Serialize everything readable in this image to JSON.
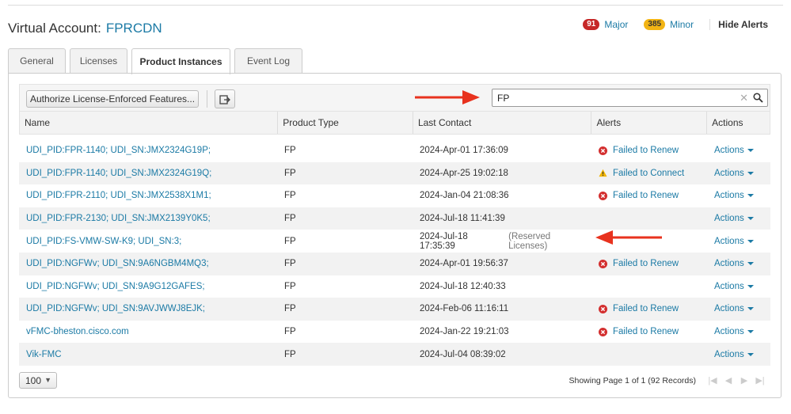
{
  "header": {
    "prefix": "Virtual Account:",
    "account": "FPRCDN"
  },
  "alerts": {
    "major_count": "91",
    "major_label": "Major",
    "minor_count": "385",
    "minor_label": "Minor",
    "hide_label": "Hide Alerts"
  },
  "tabs": [
    {
      "label": "General"
    },
    {
      "label": "Licenses"
    },
    {
      "label": "Product Instances"
    },
    {
      "label": "Event Log"
    }
  ],
  "toolbar": {
    "authorize_label": "Authorize License-Enforced Features..."
  },
  "search": {
    "value": "FP"
  },
  "table": {
    "headers": [
      "Name",
      "Product Type",
      "Last Contact",
      "Alerts",
      "Actions"
    ],
    "rows": [
      {
        "name": "UDI_PID:FPR-1140; UDI_SN:JMX2324G19P;",
        "type": "FP",
        "contact": "2024-Apr-01 17:36:09",
        "reserved": "",
        "alert": "Failed to Renew",
        "alert_kind": "error",
        "action": "Actions"
      },
      {
        "name": "UDI_PID:FPR-1140; UDI_SN:JMX2324G19Q;",
        "type": "FP",
        "contact": "2024-Apr-25 19:02:18",
        "reserved": "",
        "alert": "Failed to Connect",
        "alert_kind": "warning",
        "action": "Actions"
      },
      {
        "name": "UDI_PID:FPR-2110; UDI_SN:JMX2538X1M1;",
        "type": "FP",
        "contact": "2024-Jan-04 21:08:36",
        "reserved": "",
        "alert": "Failed to Renew",
        "alert_kind": "error",
        "action": "Actions"
      },
      {
        "name": "UDI_PID:FPR-2130; UDI_SN:JMX2139Y0K5;",
        "type": "FP",
        "contact": "2024-Jul-18 11:41:39",
        "reserved": "",
        "alert": "",
        "alert_kind": "",
        "action": "Actions"
      },
      {
        "name": "UDI_PID:FS-VMW-SW-K9; UDI_SN:3;",
        "type": "FP",
        "contact": "2024-Jul-18 17:35:39",
        "reserved": "(Reserved Licenses)",
        "alert": "",
        "alert_kind": "",
        "action": "Actions"
      },
      {
        "name": "UDI_PID:NGFWv; UDI_SN:9A6NGBM4MQ3;",
        "type": "FP",
        "contact": "2024-Apr-01 19:56:37",
        "reserved": "",
        "alert": "Failed to Renew",
        "alert_kind": "error",
        "action": "Actions"
      },
      {
        "name": "UDI_PID:NGFWv; UDI_SN:9A9G12GAFES;",
        "type": "FP",
        "contact": "2024-Jul-18 12:40:33",
        "reserved": "",
        "alert": "",
        "alert_kind": "",
        "action": "Actions"
      },
      {
        "name": "UDI_PID:NGFWv; UDI_SN:9AVJWWJ8EJK;",
        "type": "FP",
        "contact": "2024-Feb-06 11:16:11",
        "reserved": "",
        "alert": "Failed to Renew",
        "alert_kind": "error",
        "action": "Actions"
      },
      {
        "name": "vFMC-bheston.cisco.com",
        "type": "FP",
        "contact": "2024-Jan-22 19:21:03",
        "reserved": "",
        "alert": "Failed to Renew",
        "alert_kind": "error",
        "action": "Actions"
      },
      {
        "name": "Vik-FMC",
        "type": "FP",
        "contact": "2024-Jul-04 08:39:02",
        "reserved": "",
        "alert": "",
        "alert_kind": "",
        "action": "Actions"
      }
    ]
  },
  "pager": {
    "page_size": "100",
    "info": "Showing Page 1 of 1 (92 Records)"
  },
  "colors": {
    "link": "#1b7aa5",
    "major": "#c62828",
    "minor": "#f2b414",
    "annotation_arrow": "#e8321e"
  },
  "icons": {
    "error": "error-x-circle-icon",
    "warning": "warning-triangle-icon",
    "export": "export-icon",
    "search": "magnifier-icon",
    "clear": "clear-x-icon"
  }
}
